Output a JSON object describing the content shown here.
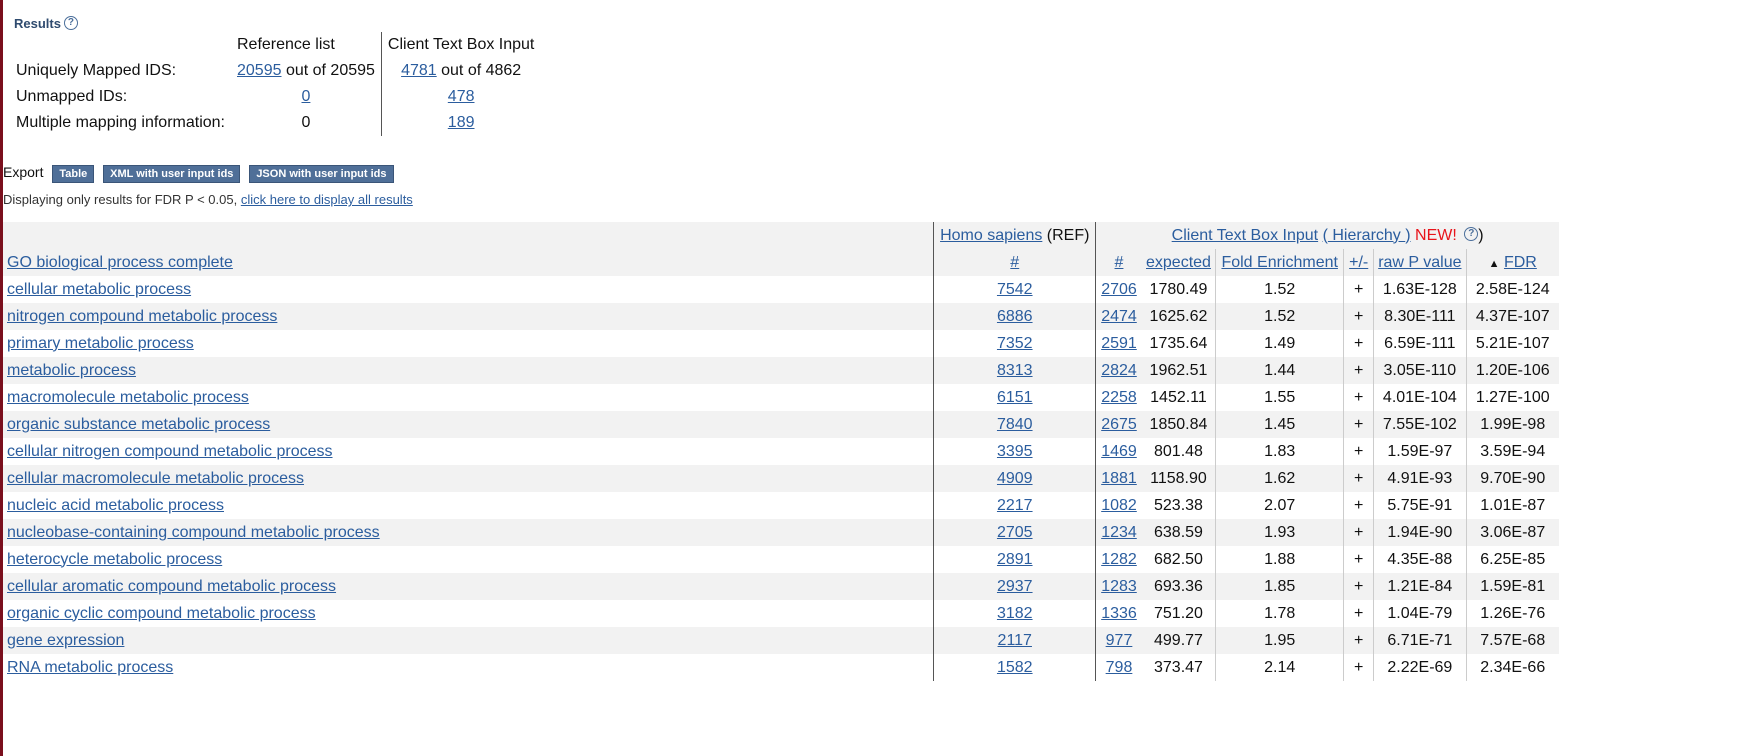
{
  "results_title": "Results",
  "mapping": {
    "col_ref": "Reference list",
    "col_client": "Client Text Box Input",
    "rows": [
      {
        "label": "Uniquely Mapped IDS:",
        "ref_link": "20595",
        "ref_text": " out of 20595",
        "client_link": "4781",
        "client_text": " out of 4862"
      },
      {
        "label": "Unmapped IDs:",
        "ref_link": "0",
        "ref_text": "",
        "client_link": "478",
        "client_text": ""
      },
      {
        "label": "Multiple mapping information:",
        "ref_link": "",
        "ref_text": "0",
        "client_link": "189",
        "client_text": ""
      }
    ]
  },
  "export": {
    "label": "Export",
    "buttons": [
      "Table",
      "XML with user input ids",
      "JSON with user input ids"
    ]
  },
  "fdr_note": {
    "text": "Displaying only results for FDR P < 0.05, ",
    "link": "click here to display all results"
  },
  "table": {
    "ref_header": "Homo sapiens",
    "ref_suffix": " (REF)",
    "client_header": "Client Text Box Input",
    "hierarchy_link": " Hierarchy ",
    "hierarchy_open": "(",
    "hierarchy_close": ")",
    "new_label": " NEW!",
    "help_icon": "?",
    "close_paren": ")",
    "col_go": "GO biological process complete",
    "col_ref_count": "#",
    "col_count": "#",
    "col_expected": "expected",
    "col_fold": "Fold Enrichment",
    "col_pm": "+/-",
    "col_raw_p": "raw P value",
    "sort_icon": "▲",
    "col_fdr": "FDR",
    "rows": [
      {
        "term": "cellular metabolic process",
        "ref": "7542",
        "count": "2706",
        "expected": "1780.49",
        "fold": "1.52",
        "pm": "+",
        "p": "1.63E-128",
        "fdr": "2.58E-124"
      },
      {
        "term": "nitrogen compound metabolic process",
        "ref": "6886",
        "count": "2474",
        "expected": "1625.62",
        "fold": "1.52",
        "pm": "+",
        "p": "8.30E-111",
        "fdr": "4.37E-107"
      },
      {
        "term": "primary metabolic process",
        "ref": "7352",
        "count": "2591",
        "expected": "1735.64",
        "fold": "1.49",
        "pm": "+",
        "p": "6.59E-111",
        "fdr": "5.21E-107"
      },
      {
        "term": "metabolic process",
        "ref": "8313",
        "count": "2824",
        "expected": "1962.51",
        "fold": "1.44",
        "pm": "+",
        "p": "3.05E-110",
        "fdr": "1.20E-106"
      },
      {
        "term": "macromolecule metabolic process",
        "ref": "6151",
        "count": "2258",
        "expected": "1452.11",
        "fold": "1.55",
        "pm": "+",
        "p": "4.01E-104",
        "fdr": "1.27E-100"
      },
      {
        "term": "organic substance metabolic process",
        "ref": "7840",
        "count": "2675",
        "expected": "1850.84",
        "fold": "1.45",
        "pm": "+",
        "p": "7.55E-102",
        "fdr": "1.99E-98"
      },
      {
        "term": "cellular nitrogen compound metabolic process",
        "ref": "3395",
        "count": "1469",
        "expected": "801.48",
        "fold": "1.83",
        "pm": "+",
        "p": "1.59E-97",
        "fdr": "3.59E-94"
      },
      {
        "term": "cellular macromolecule metabolic process",
        "ref": "4909",
        "count": "1881",
        "expected": "1158.90",
        "fold": "1.62",
        "pm": "+",
        "p": "4.91E-93",
        "fdr": "9.70E-90"
      },
      {
        "term": "nucleic acid metabolic process",
        "ref": "2217",
        "count": "1082",
        "expected": "523.38",
        "fold": "2.07",
        "pm": "+",
        "p": "5.75E-91",
        "fdr": "1.01E-87"
      },
      {
        "term": "nucleobase-containing compound metabolic process",
        "ref": "2705",
        "count": "1234",
        "expected": "638.59",
        "fold": "1.93",
        "pm": "+",
        "p": "1.94E-90",
        "fdr": "3.06E-87"
      },
      {
        "term": "heterocycle metabolic process",
        "ref": "2891",
        "count": "1282",
        "expected": "682.50",
        "fold": "1.88",
        "pm": "+",
        "p": "4.35E-88",
        "fdr": "6.25E-85"
      },
      {
        "term": "cellular aromatic compound metabolic process",
        "ref": "2937",
        "count": "1283",
        "expected": "693.36",
        "fold": "1.85",
        "pm": "+",
        "p": "1.21E-84",
        "fdr": "1.59E-81"
      },
      {
        "term": "organic cyclic compound metabolic process",
        "ref": "3182",
        "count": "1336",
        "expected": "751.20",
        "fold": "1.78",
        "pm": "+",
        "p": "1.04E-79",
        "fdr": "1.26E-76"
      },
      {
        "term": "gene expression",
        "ref": "2117",
        "count": "977",
        "expected": "499.77",
        "fold": "1.95",
        "pm": "+",
        "p": "6.71E-71",
        "fdr": "7.57E-68"
      },
      {
        "term": "RNA metabolic process",
        "ref": "1582",
        "count": "798",
        "expected": "373.47",
        "fold": "2.14",
        "pm": "+",
        "p": "2.22E-69",
        "fdr": "2.34E-66"
      }
    ]
  }
}
